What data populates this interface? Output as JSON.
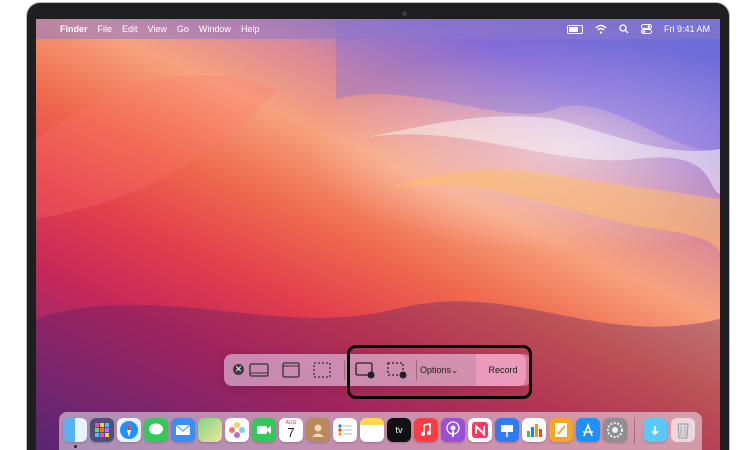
{
  "menubar": {
    "apple_symbol": "",
    "items": [
      "Finder",
      "File",
      "Edit",
      "View",
      "Go",
      "Window",
      "Help"
    ],
    "clock": "Fri 9:41 AM"
  },
  "screenshot_toolbar": {
    "close_symbol": "✕",
    "options_label": "Options",
    "options_chevron": "⌄",
    "record_label": "Record"
  },
  "colors": {
    "highlight": "#000000",
    "record_bg": "#ffa0c8"
  },
  "dock": {
    "apps": [
      "finder-icon",
      "launchpad-icon",
      "safari-icon",
      "messages-icon",
      "mail-icon",
      "maps-icon",
      "photos-icon",
      "facetime-icon",
      "calendar-icon",
      "contacts-icon",
      "reminders-icon",
      "notes-icon",
      "tv-icon",
      "music-icon",
      "podcasts-icon",
      "news-icon",
      "keynote-icon",
      "numbers-icon",
      "pages-icon",
      "app-store-icon",
      "system-preferences-icon",
      "downloads-folder-icon",
      "trash-icon"
    ],
    "calendar_month": "AUG",
    "calendar_day": "7",
    "tv_label": "tv"
  }
}
